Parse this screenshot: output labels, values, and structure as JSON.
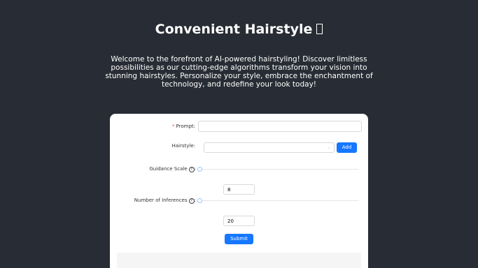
{
  "header": {
    "title": "Convenient Hairstyle",
    "intro": "Welcome to the forefront of AI-powered hairstyling! Discover limitless possibilities as our cutting-edge algorithms transform your vision into stunning hairstyles. Personalize your style, embrace the enchantment of technology, and redefine your look today!"
  },
  "form": {
    "prompt": {
      "required_mark": "*",
      "label": "Prompt",
      "value": ""
    },
    "hairstyle": {
      "label": "Hairstyle",
      "selected": "",
      "add_label": "Add"
    },
    "guidance_scale": {
      "label": "Guidance Scale",
      "help_icon": "question-circle-icon",
      "value": "8",
      "slider_fraction": 0
    },
    "num_inferences": {
      "label": "Number of Inferences",
      "help_icon": "question-circle-icon",
      "value": "20",
      "slider_fraction": 0
    },
    "submit_label": "Submit"
  },
  "colors": {
    "background": "#282c34",
    "primary": "#1677ff",
    "required": "#ff4d4f",
    "slider_handle": "#91caff"
  }
}
